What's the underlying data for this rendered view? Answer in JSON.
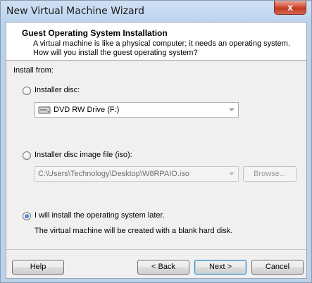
{
  "window": {
    "title": "New Virtual Machine Wizard",
    "close_glyph": "x"
  },
  "header": {
    "title": "Guest Operating System Installation",
    "description": "A virtual machine is like a physical computer; it needs an operating system. How will you install the guest operating system?"
  },
  "install_from_label": "Install from:",
  "options": {
    "installer_disc": {
      "label": "Installer disc:",
      "selected": false,
      "drive_value": "DVD RW Drive (F:)",
      "icon": "dvd-drive-icon"
    },
    "iso": {
      "label": "Installer disc image file (iso):",
      "selected": false,
      "path_value": "C:\\Users\\Technology\\Desktop\\W8RPAIO.iso",
      "browse_label": "Browse..."
    },
    "later": {
      "label": "I will install the operating system later.",
      "selected": true,
      "note": "The virtual machine will be created with a blank hard disk."
    }
  },
  "footer": {
    "help": "Help",
    "back": "< Back",
    "next": "Next >",
    "cancel": "Cancel"
  }
}
